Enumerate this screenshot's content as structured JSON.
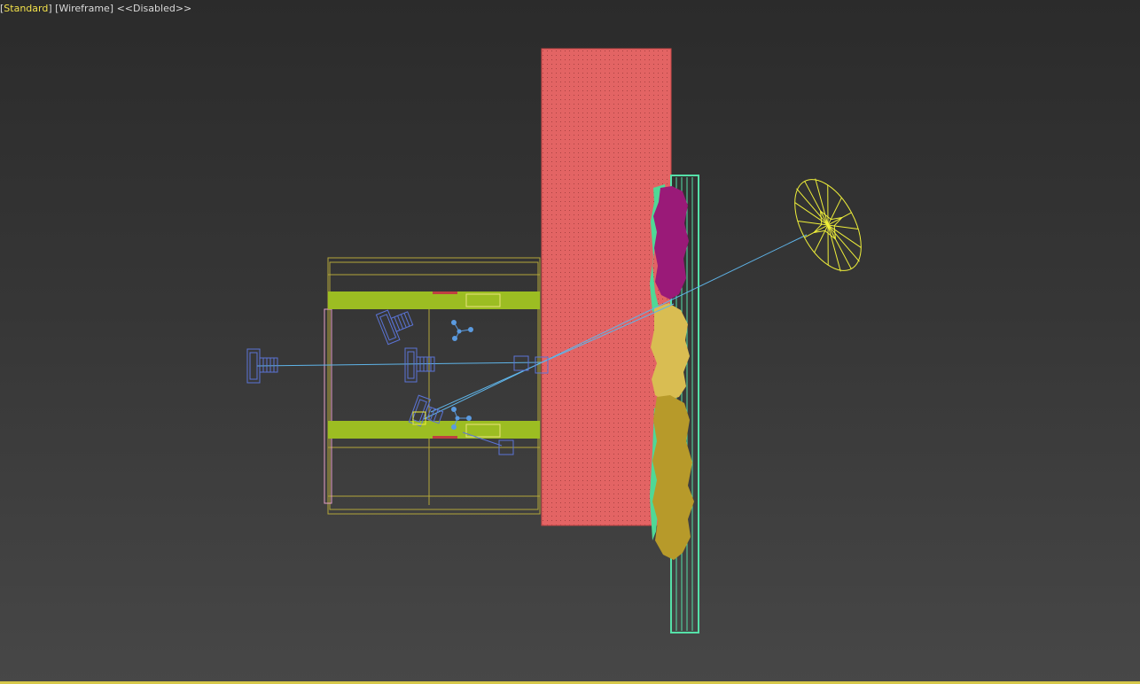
{
  "viewport": {
    "label": {
      "shading_mode": "Standard",
      "display_mode": "Wireframe",
      "extra": "<<Disabled>>"
    },
    "colors": {
      "background_top": "#2b2b2b",
      "background_bottom": "#474747",
      "active_label": "#f2e14a",
      "red_wall": "#e06060",
      "teal_frame": "#55e0a8",
      "yellow_box": "#b3a63a",
      "lime_bars": "#9cbd22",
      "blue_objects": "#5b74d6",
      "light_ray": "#5fb4e8",
      "spot_light": "#f0f03a",
      "magenta_scatter": "#9a1a78",
      "gold_scatter": "#d7bd4e",
      "olive_scatter": "#b89a28"
    },
    "icons": [
      "camera-icon",
      "light-target-icon",
      "helper-icon",
      "spot-light-icon"
    ]
  }
}
